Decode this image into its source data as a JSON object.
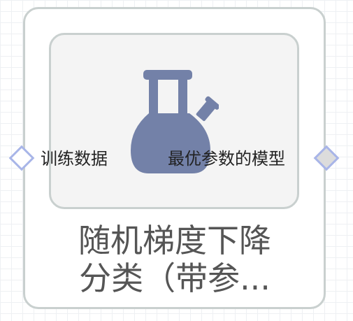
{
  "node": {
    "title_line1": "随机梯度下降",
    "title_line2": "分类（带参...",
    "icon": "flask-icon",
    "input_port_label": "训练数据",
    "output_port_label": "最优参数的模型"
  },
  "colors": {
    "flask": "#7381a8",
    "border": "#c9d0cf",
    "port_border": "#a8b5e8",
    "title": "#555555"
  }
}
